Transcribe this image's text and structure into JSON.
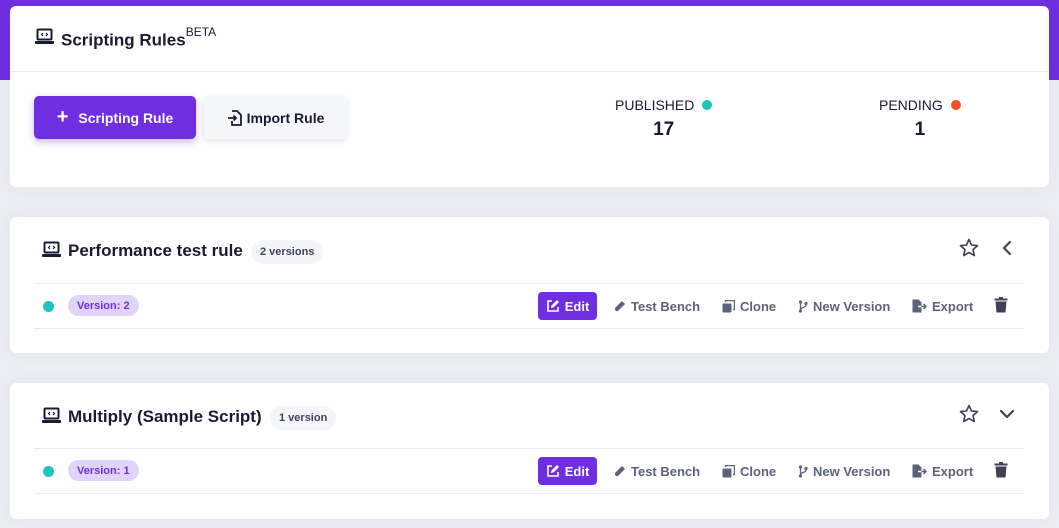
{
  "header": {
    "title": "Scripting Rules",
    "title_sup": "BETA",
    "title_icon": "laptop-code-icon",
    "add_button_label": "Scripting Rule",
    "import_button_label": "Import Rule",
    "stats": [
      {
        "label": "PUBLISHED",
        "value": "17",
        "color": "#1bc5bd"
      },
      {
        "label": "PENDING",
        "value": "1",
        "color": "#f64e1f"
      }
    ]
  },
  "rules": [
    {
      "name": "Performance test rule",
      "versions_label": "2 versions",
      "expanded": true,
      "version": {
        "label": "Version: 2",
        "status_color": "#1bc5bd"
      }
    },
    {
      "name": "Multiply (Sample Script)",
      "versions_label": "1 version",
      "expanded": false,
      "version": {
        "label": "Version: 1",
        "status_color": "#1bc5bd"
      }
    }
  ],
  "actions": {
    "edit": "Edit",
    "test_bench": "Test Bench",
    "clone": "Clone",
    "new_version": "New Version",
    "export": "Export"
  },
  "colors": {
    "accent": "#6f2ee0",
    "published": "#1bc5bd",
    "pending": "#f64e1f",
    "version_badge_bg": "#e1d4fb"
  }
}
